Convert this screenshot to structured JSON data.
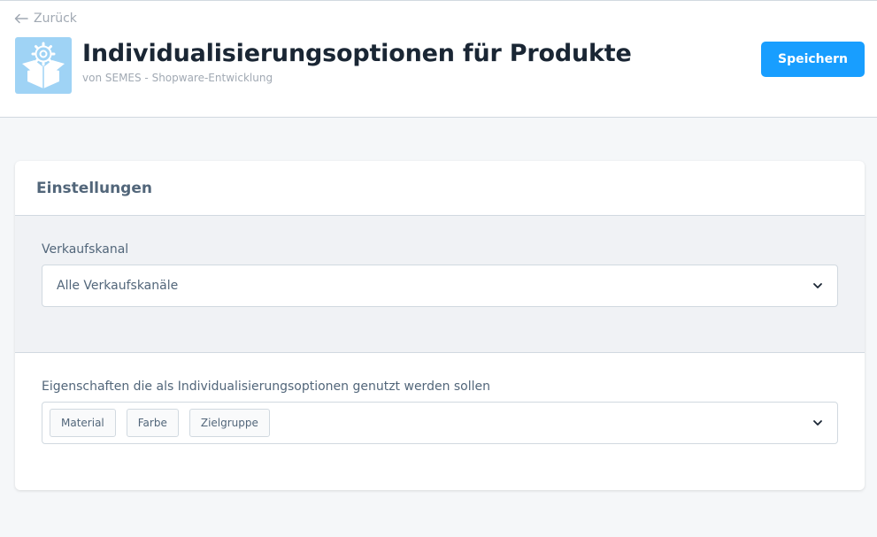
{
  "header": {
    "back_label": "Zurück",
    "title": "Individualisierungsoptionen für Produkte",
    "subtitle": "von SEMES - Shopware-Entwicklung",
    "save_label": "Speichern",
    "icon": "plugin-box-gear-icon"
  },
  "settings": {
    "title": "Einstellungen",
    "sales_channel": {
      "label": "Verkaufskanal",
      "value": "Alle Verkaufskanäle"
    },
    "properties": {
      "label": "Eigenschaften die als Individualisierungsoptionen genutzt werden sollen",
      "tags": [
        "Material",
        "Farbe",
        "Zielgruppe"
      ]
    }
  },
  "colors": {
    "accent": "#189eff",
    "icon_bg": "#9fd3f5",
    "text": "#1a2634",
    "muted": "#a1a9b3"
  }
}
